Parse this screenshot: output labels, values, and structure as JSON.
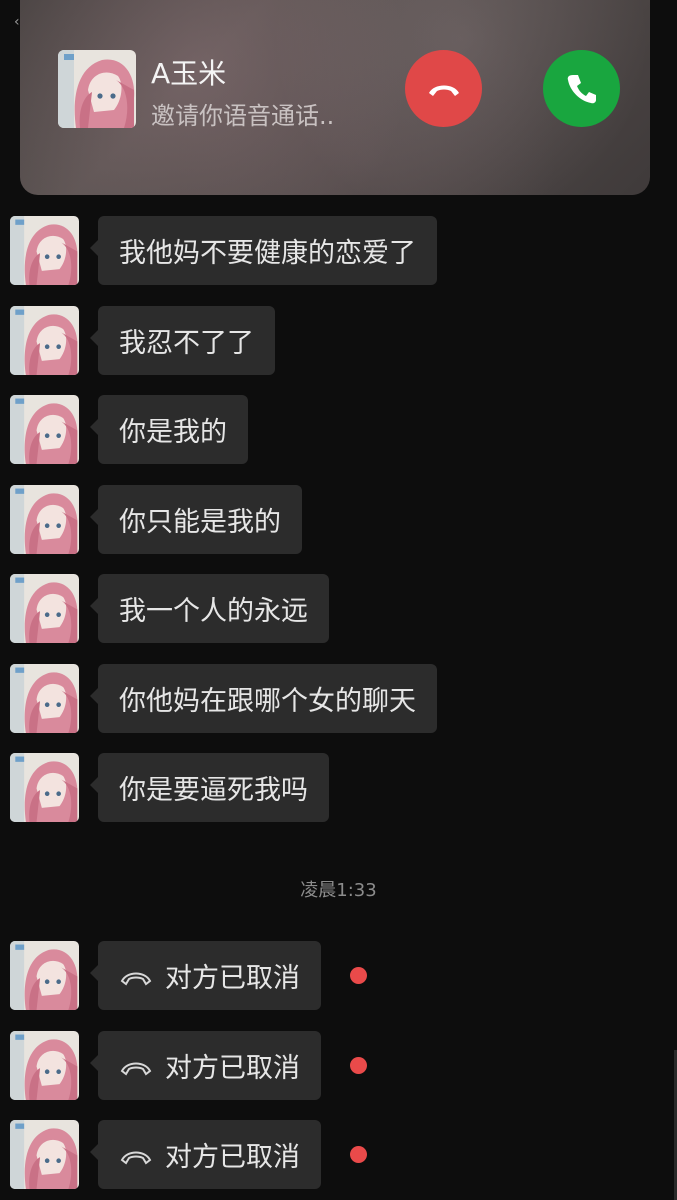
{
  "banner": {
    "caller_name": "A玉米",
    "subtitle": "邀请你语音通话..",
    "decline_icon": "phone-hangup-icon",
    "accept_icon": "phone-accept-icon",
    "colors": {
      "decline": "#e04848",
      "accept": "#19a63f"
    }
  },
  "messages": [
    {
      "text": "我他妈不要健康的恋爱了"
    },
    {
      "text": "我忍不了了"
    },
    {
      "text": "你是我的"
    },
    {
      "text": "你只能是我的"
    },
    {
      "text": "我一个人的永远"
    },
    {
      "text": "你他妈在跟哪个女的聊天"
    },
    {
      "text": "你是要逼死我吗"
    }
  ],
  "timestamp": "凌晨1:33",
  "missed_calls": [
    {
      "text": "对方已取消",
      "icon": "missed-call-icon",
      "unread": true
    },
    {
      "text": "对方已取消",
      "icon": "missed-call-icon",
      "unread": true
    },
    {
      "text": "对方已取消",
      "icon": "missed-call-icon",
      "unread": true
    }
  ]
}
